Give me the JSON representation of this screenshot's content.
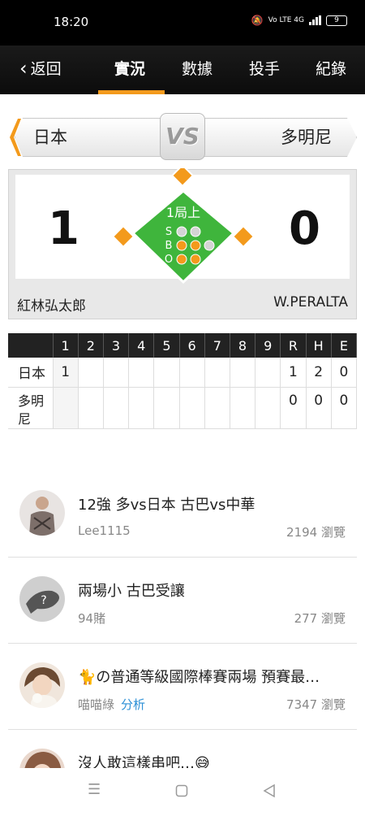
{
  "status": {
    "time": "18:20",
    "network": "Vo LTE 4G",
    "battery": "9"
  },
  "nav": {
    "back_label": "返回",
    "tabs": [
      {
        "label": "實況",
        "active": true
      },
      {
        "label": "數據",
        "active": false
      },
      {
        "label": "投手",
        "active": false
      },
      {
        "label": "紀錄",
        "active": false
      }
    ]
  },
  "matchup": {
    "home_team": "日本",
    "away_team": "多明尼",
    "vs_label": "VS"
  },
  "game": {
    "score_left": "1",
    "score_right": "0",
    "inning": "1局上",
    "count": {
      "strikes": 0,
      "balls": 2,
      "outs": 2
    },
    "count_labels": {
      "s": "S",
      "b": "B",
      "o": "O"
    },
    "pitcher_left": "紅林弘太郎",
    "pitcher_right": "W.PERALTA"
  },
  "linescore": {
    "headers": [
      "1",
      "2",
      "3",
      "4",
      "5",
      "6",
      "7",
      "8",
      "9",
      "R",
      "H",
      "E"
    ],
    "rows": [
      {
        "team": "日本",
        "innings": [
          "1",
          "",
          "",
          "",
          "",
          "",
          "",
          "",
          ""
        ],
        "r": "1",
        "h": "2",
        "e": "0"
      },
      {
        "team": "多明尼",
        "innings": [
          "",
          "",
          "",
          "",
          "",
          "",
          "",
          "",
          ""
        ],
        "r": "0",
        "h": "0",
        "e": "0"
      }
    ]
  },
  "posts": [
    {
      "title": "12強 多vs日本 古巴vs中華",
      "author": "Lee1115",
      "tag": "",
      "views": "2194 瀏覽"
    },
    {
      "title": "兩場小 古巴受讓",
      "author": "94賭",
      "tag": "",
      "views": "277 瀏覽"
    },
    {
      "title": "🐈の普通等級國際棒賽兩場 預賽最…",
      "author": "喵喵綠",
      "tag": "分析",
      "views": "7347 瀏覽"
    },
    {
      "title": "沒人敢這樣串吧…😅",
      "author": "",
      "tag": "",
      "views": ""
    }
  ],
  "colors": {
    "accent": "#f39a1c",
    "field_green": "#3fb53c",
    "tag_blue": "#2a8fd6"
  }
}
